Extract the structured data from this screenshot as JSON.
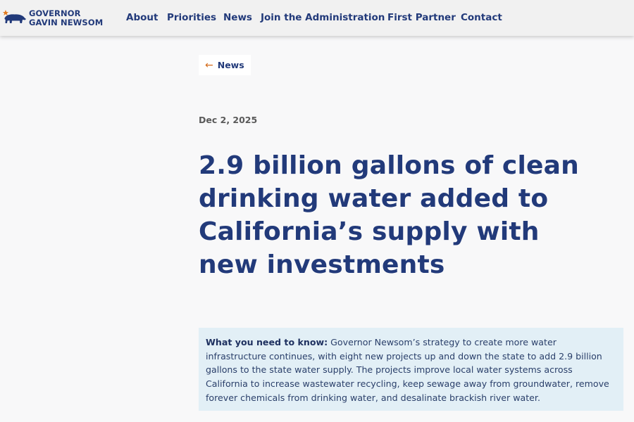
{
  "header": {
    "logo": {
      "line1": "GOVERNOR",
      "line2": "GAVIN NEWSOM",
      "icon": "california-bear-icon"
    },
    "nav": [
      "About",
      "Priorities",
      "News",
      "Join the Administration",
      "First Partner",
      "Contact"
    ]
  },
  "back_link": {
    "label": "News",
    "icon": "arrow-left-icon"
  },
  "article": {
    "date": "Dec 2, 2025",
    "title": "2.9 billion gallons of clean drinking water added to California’s supply with new investments",
    "summary_lead": "What you need to know:",
    "summary_text": "Governor Newsom’s strategy to create more water infrastructure continues, with eight new projects up and down the state to add 2.9 billion gallons to the state water supply. The projects improve local water systems across California to increase wastewater recycling, keep sewage away from groundwater, remove forever chemicals from drinking water, and desalinate brackish river water."
  },
  "colors": {
    "brand_navy": "#223a7a",
    "accent_orange": "#d46b1a",
    "summary_bg": "#e2eff6"
  }
}
